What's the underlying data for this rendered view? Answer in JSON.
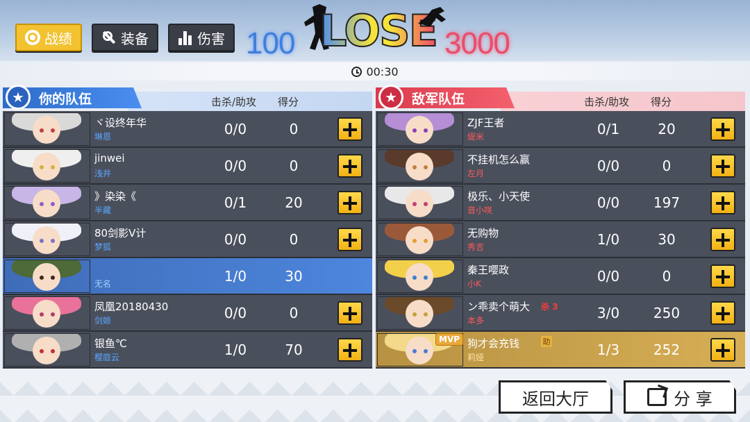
{
  "tabs": [
    {
      "label": "战绩",
      "icon": "record-icon",
      "active": true
    },
    {
      "label": "装备",
      "icon": "equipment-icon",
      "active": false
    },
    {
      "label": "伤害",
      "icon": "damage-icon",
      "active": false
    }
  ],
  "header": {
    "score_left": "100",
    "result": "LOSE",
    "score_right": "3000",
    "timer": "00:30"
  },
  "left_team": {
    "title": "你的队伍",
    "col_ka": "击杀/助攻",
    "col_score": "得分",
    "players": [
      {
        "name": "ヾ设终年华",
        "hero": "琳恩",
        "ka": "0/0",
        "score": "0",
        "hair": "#d9d9d9",
        "eye": "#c04040"
      },
      {
        "name": "jinwei",
        "hero": "浅井",
        "ka": "0/0",
        "score": "0",
        "hair": "#efefef",
        "eye": "#d8b040"
      },
      {
        "name": "》染染《",
        "hero": "半藏",
        "ka": "0/1",
        "score": "20",
        "hair": "#c8b6e6",
        "eye": "#8e5fc6"
      },
      {
        "name": "80剑影V计",
        "hero": "梦狐",
        "ka": "0/0",
        "score": "0",
        "hair": "#f0f0f8",
        "eye": "#7d70c9"
      },
      {
        "name": "",
        "hero": "无名",
        "ka": "1/0",
        "score": "30",
        "hair": "#4d6a38",
        "eye": "#3a2a1a",
        "me": true
      },
      {
        "name": "凤凰20180430",
        "hero": "剑姬",
        "ka": "0/0",
        "score": "0",
        "hair": "#e8729a",
        "eye": "#b83a6a"
      },
      {
        "name": "银鱼℃",
        "hero": "樱庭云",
        "ka": "1/0",
        "score": "70",
        "hair": "#b0b0b0",
        "eye": "#c03030"
      }
    ]
  },
  "right_team": {
    "title": "敌军队伍",
    "col_ka": "击杀/助攻",
    "col_score": "得分",
    "players": [
      {
        "name": "ZJF王者",
        "hero": "缇米",
        "ka": "0/1",
        "score": "20",
        "hair": "#b58ed6",
        "eye": "#8a3fb8"
      },
      {
        "name": "不挂机怎么赢",
        "hero": "左月",
        "ka": "0/0",
        "score": "0",
        "hair": "#5a3a2a",
        "eye": "#c08040"
      },
      {
        "name": "极乐、小天使",
        "hero": "音小咲",
        "ka": "0/0",
        "score": "197",
        "hair": "#e8e8e8",
        "eye": "#c04070"
      },
      {
        "name": "无购物",
        "hero": "秀吉",
        "ka": "1/0",
        "score": "30",
        "hair": "#9a5a3a",
        "eye": "#e0a030"
      },
      {
        "name": "秦王嘤政",
        "hero": "小K",
        "ka": "0/0",
        "score": "0",
        "hair": "#f3d04a",
        "eye": "#3a80d0"
      },
      {
        "name": "ン乖卖个萌大",
        "hero": "本多",
        "ka": "3/0",
        "score": "250",
        "hair": "#6a4a2a",
        "eye": "#c8a040",
        "kill_badge": "杀 3"
      },
      {
        "name": "狗才会充钱",
        "hero": "莉娅",
        "ka": "1/3",
        "score": "252",
        "hair": "#f4d98a",
        "eye": "#4a7ad0",
        "mvp": "MVP",
        "assist_badge": "助"
      }
    ]
  },
  "buttons": {
    "back": "返回大厅",
    "share": "分 享"
  },
  "colors": {
    "blue_team": "#3f7fd9",
    "red_team": "#ea4d6a",
    "active_tab": "#f2c230",
    "plus_button": "#f2b114"
  }
}
